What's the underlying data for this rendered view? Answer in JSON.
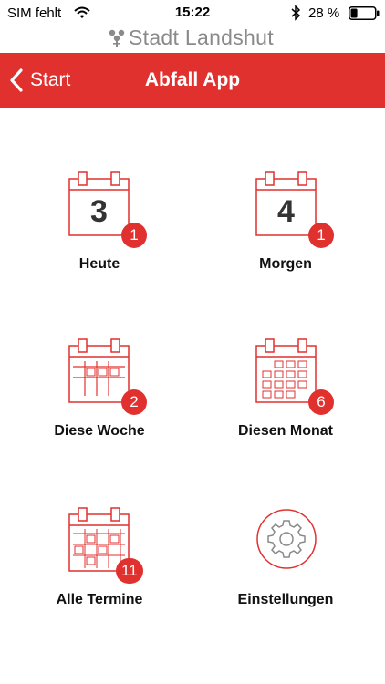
{
  "status_bar": {
    "carrier": "SIM fehlt",
    "time": "15:22",
    "battery_text": "28 %",
    "battery_level": 0.28
  },
  "brand": {
    "name": "Stadt Landshut"
  },
  "nav": {
    "back_label": "Start",
    "title": "Abfall App"
  },
  "colors": {
    "accent": "#e1312f",
    "icon_line": "#e1312f",
    "text": "#111111",
    "brand_gray": "#8a8a8a"
  },
  "tiles": [
    {
      "label": "Heute",
      "icon": "calendar-day-icon",
      "day_number": "3",
      "badge": "1"
    },
    {
      "label": "Morgen",
      "icon": "calendar-day-icon",
      "day_number": "4",
      "badge": "1"
    },
    {
      "label": "Diese Woche",
      "icon": "calendar-week-icon",
      "badge": "2"
    },
    {
      "label": "Diesen Monat",
      "icon": "calendar-month-icon",
      "badge": "6"
    },
    {
      "label": "Alle Termine",
      "icon": "calendar-all-icon",
      "badge": "11"
    },
    {
      "label": "Einstellungen",
      "icon": "gear-icon"
    }
  ]
}
